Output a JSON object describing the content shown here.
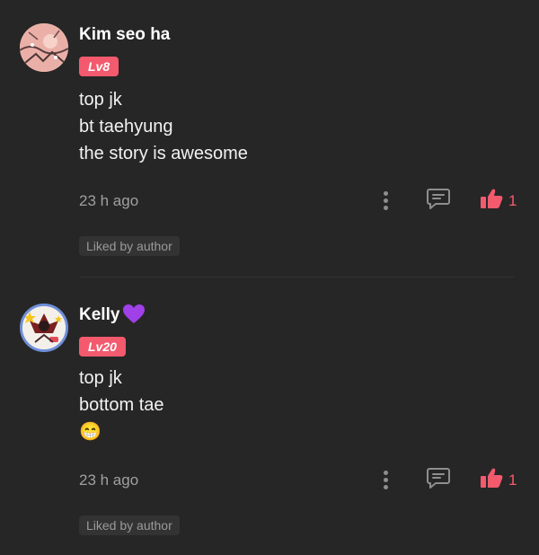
{
  "comments": [
    {
      "username": "Kim seo ha",
      "level": "Lv8",
      "lines": [
        "top jk",
        "bt taehyung",
        "the story is awesome"
      ],
      "time": "23 h ago",
      "like_count": "1",
      "liked_by_author": "Liked by author",
      "avatar_icon": "profile-avatar",
      "reply_icon": "reply-icon",
      "like_icon": "thumbs-up-icon"
    },
    {
      "username": "Kelly",
      "username_emoji": "purple-heart",
      "level": "Lv20",
      "lines": [
        "top jk",
        "bottom tae",
        "😁"
      ],
      "time": "23 h ago",
      "like_count": "1",
      "liked_by_author": "Liked by author",
      "avatar_icon": "profile-avatar",
      "reply_icon": "reply-icon",
      "like_icon": "thumbs-up-icon"
    }
  ],
  "colors": {
    "background": "#262626",
    "accent": "#f35a6d",
    "muted_text": "#a0a0a0",
    "badge_bg": "#333333",
    "heart": "#a040e8"
  }
}
